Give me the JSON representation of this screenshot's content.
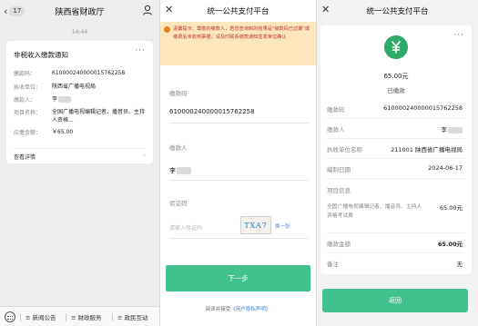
{
  "chat": {
    "back_count": "17",
    "title": "陕西省财政厅",
    "timestamp": "14:44",
    "card": {
      "title": "非税收入缴款通知",
      "rows": [
        {
          "label": "缴款码：",
          "value": "610000240000015762258"
        },
        {
          "label": "执收单位：",
          "value": "陕西省广播电视局"
        },
        {
          "label": "缴款人：",
          "value": "李"
        },
        {
          "label": "项目名称：",
          "value": "全国广播电视编辑记者、播音员、主持人资格..."
        },
        {
          "label": "应缴金额：",
          "value": "￥65.00"
        }
      ],
      "detail_link": "查看详情"
    },
    "menu": [
      "新闻公告",
      "财政服务",
      "政民互动"
    ]
  },
  "form": {
    "title": "统一公共支付平台",
    "notice": "温馨提示：尊敬的缴款人，若您查询到的结果是\"缴款码已过期\"或缴费后未收到票据，请及时联系缴款通知签发单位确认",
    "code_label": "缴款码",
    "code_value": "610000240000015762258",
    "payer_label": "缴款人",
    "payer_value": "李",
    "captcha_label": "验证码",
    "captcha_placeholder": "请输入验证码",
    "captcha_image_text": "TXA7",
    "captcha_refresh": "换一张",
    "next_button": "下一步",
    "agree_prefix": "阅读并接受",
    "agree_link": "《用户隐私声明》"
  },
  "receipt": {
    "title": "统一公共支付平台",
    "amount": "65.00元",
    "status": "已缴款",
    "rows": [
      {
        "label": "缴款码",
        "value": "610000240000015762258"
      },
      {
        "label": "缴款人",
        "value": "李"
      },
      {
        "label": "执收单位名称",
        "value": "211001 陕西省广播电视局"
      },
      {
        "label": "编制日期",
        "value": "2024-06-17"
      }
    ],
    "item_section": "项目信息",
    "item_name": "全国广播电视编辑记者、播音员、主持人资格考试费",
    "item_amount": "65.00元",
    "total_label": "缴款金额",
    "total_value": "65.00元",
    "remark_label": "备注",
    "remark_value": "无",
    "return_button": "返回"
  },
  "colors": {
    "accent": "#41c28f",
    "notice_bg": "#fbe6bd",
    "notice_text": "#c0392b",
    "link": "#3f7fd9"
  }
}
